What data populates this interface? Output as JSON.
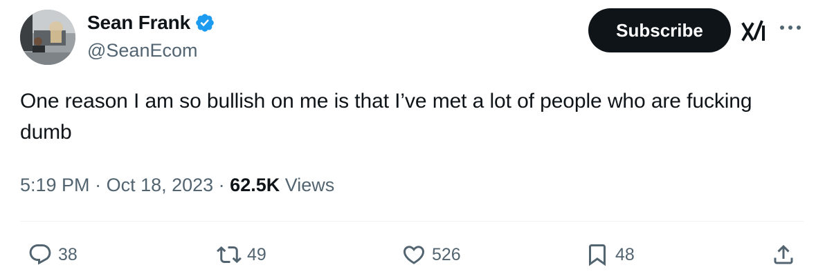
{
  "author": {
    "display_name": "Sean Frank",
    "handle": "@SeanEcom",
    "verified_icon": "verified-badge-icon"
  },
  "header": {
    "subscribe_label": "Subscribe",
    "grok_icon": "grok-icon",
    "more_icon": "more-icon"
  },
  "tweet": {
    "text": "One reason I am so bullish on me is that I’ve met a lot of people who are fucking dumb",
    "time": "5:19 PM",
    "date": "Oct 18, 2023",
    "views_count": "62.5K",
    "views_label": "Views"
  },
  "actions": {
    "replies": "38",
    "retweets": "49",
    "likes": "526",
    "bookmarks": "48"
  },
  "colors": {
    "text": "#0f1419",
    "secondary": "#536471",
    "verified": "#1d9bf0",
    "button_bg": "#0f1419"
  }
}
